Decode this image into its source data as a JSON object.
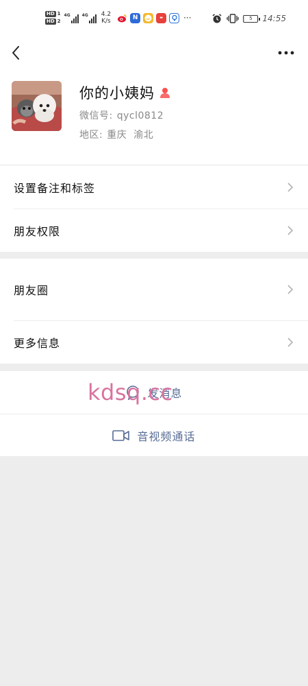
{
  "status_bar": {
    "hd1": "HD",
    "hd1_num": "1",
    "hd2": "HD",
    "hd2_num": "2",
    "net1": "4G",
    "net2": "4G",
    "speed_value": "4.2",
    "speed_unit": "K/s",
    "more": "···",
    "battery_level": "5",
    "battery_fraction": 0.05,
    "time": "14:55",
    "app_icons": [
      "weibo-icon",
      "n-app-icon",
      "smile-app-icon",
      "red-app-icon",
      "blue-app-icon"
    ]
  },
  "nav": {
    "back_icon": "chevron-left-icon",
    "more_icon": "more-dots-icon"
  },
  "profile": {
    "name": "你的小姨妈",
    "gender_icon": "female-icon",
    "wechat_id_label": "微信号:",
    "wechat_id": "qycl0812",
    "region_label": "地区:",
    "region_city": "重庆",
    "region_district": "渝北"
  },
  "menu": {
    "remark_tags": "设置备注和标签",
    "friend_permissions": "朋友权限",
    "moments": "朋友圈",
    "more_info": "更多信息"
  },
  "actions": {
    "send_message": "发消息",
    "video_call": "音视频通话"
  },
  "watermark": "kdsq.cc",
  "colors": {
    "link": "#576b95",
    "background": "#ededed",
    "watermark": "#d9739f"
  }
}
